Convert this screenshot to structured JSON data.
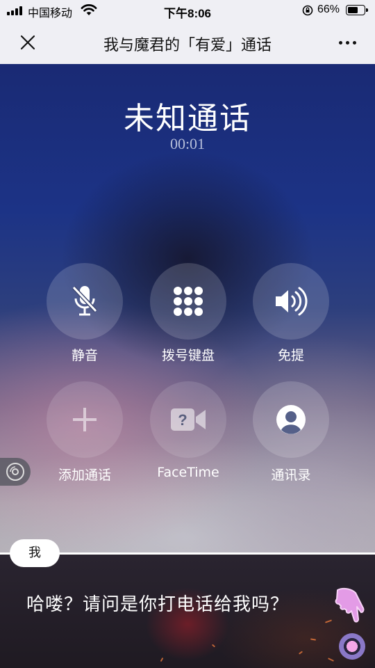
{
  "status_bar": {
    "carrier": "中国移动",
    "time": "下午8:06",
    "battery": "66%",
    "battery_level": 0.66
  },
  "nav": {
    "title": "我与魔君的「有爱」通话",
    "close_icon": "close-icon",
    "more_icon": "more-icon"
  },
  "call": {
    "title": "未知通话",
    "timer": "00:01",
    "controls": [
      {
        "label": "静音",
        "icon": "mute-mic-icon"
      },
      {
        "label": "拨号键盘",
        "icon": "keypad-icon"
      },
      {
        "label": "免提",
        "icon": "speaker-icon"
      },
      {
        "label": "添加通话",
        "icon": "plus-icon"
      },
      {
        "label": "FaceTime",
        "icon": "facetime-icon"
      },
      {
        "label": "通讯录",
        "icon": "contacts-icon"
      }
    ]
  },
  "dialog": {
    "speaker": "我",
    "text": "哈喽？请问是你打电话给我吗？",
    "hand_icon": "pointing-hand-icon",
    "record_icon": "record-icon"
  },
  "colors": {
    "nav_bg": "#efeff4",
    "call_bg_top": "#1a2a74",
    "dialog_bg": "#231e27",
    "hand_color": "#e39be6"
  }
}
